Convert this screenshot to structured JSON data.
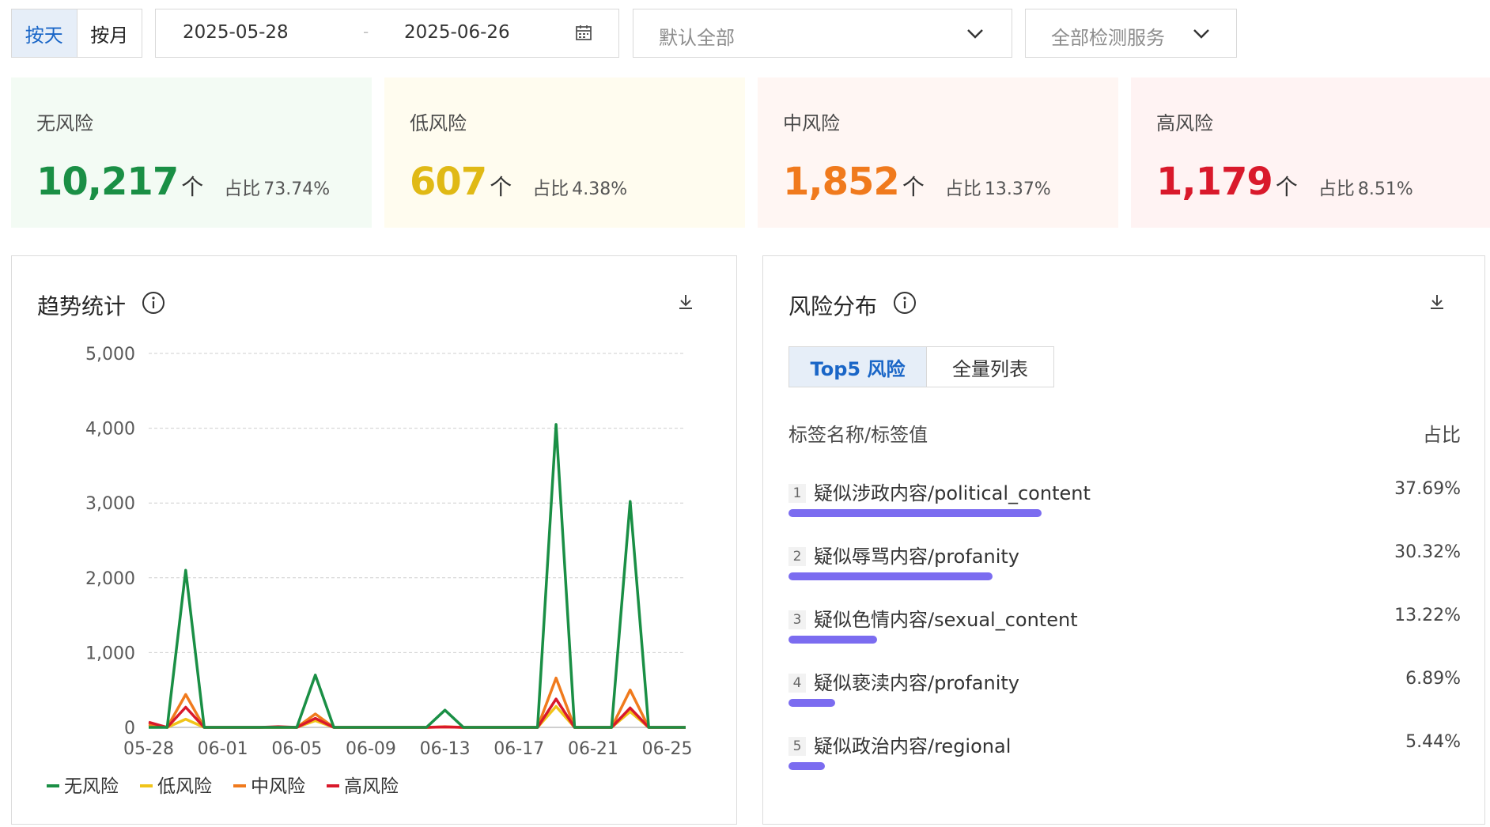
{
  "toolbar": {
    "by_day": "按天",
    "by_month": "按月",
    "start_date": "2025-05-28",
    "date_separator": "-",
    "end_date": "2025-06-26",
    "scope_select": "默认全部",
    "service_select": "全部检测服务"
  },
  "stats": [
    {
      "label": "无风险",
      "count": "10,217",
      "unit": "个",
      "share_label": "占比",
      "share": "73.74%",
      "color": "#1a8f45",
      "bg": "#f3fbf4"
    },
    {
      "label": "低风险",
      "count": "607",
      "unit": "个",
      "share_label": "占比",
      "share": "4.38%",
      "color": "#e0b915",
      "bg": "#fffcef"
    },
    {
      "label": "中风险",
      "count": "1,852",
      "unit": "个",
      "share_label": "占比",
      "share": "13.37%",
      "color": "#f07a1d",
      "bg": "#fff6f3"
    },
    {
      "label": "高风险",
      "count": "1,179",
      "unit": "个",
      "share_label": "占比",
      "share": "8.51%",
      "color": "#d9192b",
      "bg": "#fff3f3"
    }
  ],
  "trend_panel": {
    "title": "趋势统计"
  },
  "risk_panel": {
    "title": "风险分布",
    "tab_top5": "Top5 风险",
    "tab_all": "全量列表",
    "col_name": "标签名称/标签值",
    "col_share": "占比",
    "items": [
      {
        "rank": "1",
        "name": "疑似涉政内容/political_content",
        "share": "37.69%",
        "fraction": 0.3769
      },
      {
        "rank": "2",
        "name": "疑似辱骂内容/profanity",
        "share": "30.32%",
        "fraction": 0.3032
      },
      {
        "rank": "3",
        "name": "疑似色情内容/sexual_content",
        "share": "13.22%",
        "fraction": 0.1322
      },
      {
        "rank": "4",
        "name": "疑似亵渎内容/profanity",
        "share": "6.89%",
        "fraction": 0.0689
      },
      {
        "rank": "5",
        "name": "疑似政治内容/regional",
        "share": "5.44%",
        "fraction": 0.0544
      }
    ]
  },
  "chart_data": {
    "type": "line",
    "title": "趋势统计",
    "xlabel": "",
    "ylabel": "",
    "ylim": [
      0,
      5000
    ],
    "yticks": [
      "0",
      "1,000",
      "2,000",
      "3,000",
      "4,000",
      "5,000"
    ],
    "xticks": [
      "05-28",
      "06-01",
      "06-05",
      "06-09",
      "06-13",
      "06-17",
      "06-21",
      "06-25"
    ],
    "x": [
      "05-28",
      "05-29",
      "05-30",
      "05-31",
      "06-01",
      "06-02",
      "06-03",
      "06-04",
      "06-05",
      "06-06",
      "06-07",
      "06-08",
      "06-09",
      "06-10",
      "06-11",
      "06-12",
      "06-13",
      "06-14",
      "06-15",
      "06-16",
      "06-17",
      "06-18",
      "06-19",
      "06-20",
      "06-21",
      "06-22",
      "06-23",
      "06-24",
      "06-25",
      "06-26"
    ],
    "grid": true,
    "legend_position": "bottom-left",
    "series": [
      {
        "name": "无风险",
        "color": "#1a8f45",
        "values": [
          0,
          0,
          2100,
          0,
          0,
          0,
          0,
          0,
          0,
          700,
          0,
          0,
          0,
          0,
          0,
          0,
          230,
          0,
          0,
          0,
          0,
          0,
          4050,
          0,
          0,
          0,
          3020,
          0,
          0,
          0
        ]
      },
      {
        "name": "低风险",
        "color": "#f0c419",
        "values": [
          20,
          0,
          110,
          0,
          0,
          0,
          0,
          0,
          0,
          90,
          0,
          0,
          0,
          0,
          0,
          0,
          5,
          0,
          0,
          0,
          0,
          0,
          280,
          0,
          0,
          0,
          210,
          0,
          0,
          0
        ]
      },
      {
        "name": "中风险",
        "color": "#f07a1d",
        "values": [
          40,
          0,
          440,
          0,
          0,
          0,
          0,
          0,
          0,
          180,
          0,
          0,
          0,
          0,
          0,
          0,
          10,
          0,
          0,
          0,
          0,
          0,
          660,
          0,
          0,
          0,
          500,
          0,
          0,
          0
        ]
      },
      {
        "name": "高风险",
        "color": "#d9192b",
        "values": [
          70,
          0,
          270,
          0,
          0,
          0,
          0,
          10,
          0,
          120,
          0,
          0,
          0,
          0,
          0,
          0,
          5,
          0,
          0,
          0,
          0,
          0,
          380,
          0,
          0,
          0,
          260,
          0,
          0,
          0
        ]
      }
    ]
  }
}
